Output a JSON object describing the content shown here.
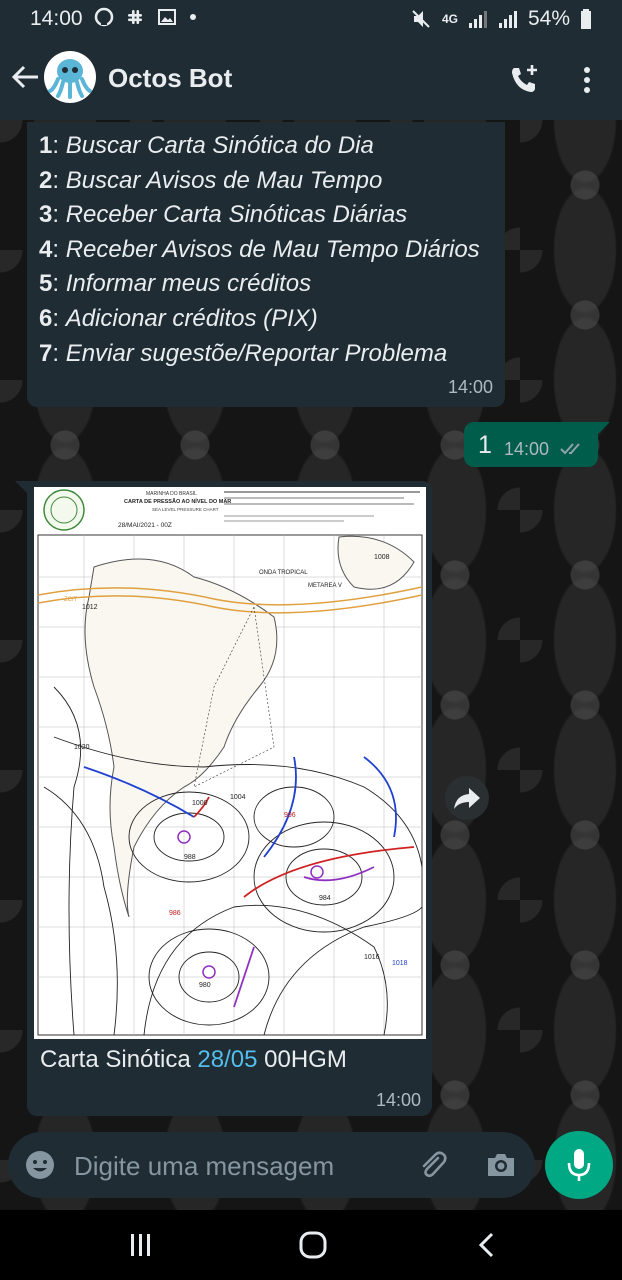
{
  "status_bar": {
    "time": "14:00",
    "battery": "54%",
    "network": "4G"
  },
  "header": {
    "contact_name": "Octos Bot"
  },
  "menu_message": {
    "items": [
      {
        "number": "1",
        "text": "Buscar Carta Sinótica do Dia"
      },
      {
        "number": "2",
        "text": "Buscar Avisos de Mau Tempo"
      },
      {
        "number": "3",
        "text": "Receber Carta Sinóticas Diárias"
      },
      {
        "number": "4",
        "text": "Receber Avisos de Mau Tempo Diários"
      },
      {
        "number": "5",
        "text": "Informar meus créditos"
      },
      {
        "number": "6",
        "text": "Adicionar créditos (PIX)"
      },
      {
        "number": "7",
        "text": "Enviar sugestõe/Reportar Problema"
      }
    ],
    "time": "14:00"
  },
  "sent_message": {
    "text": "1",
    "time": "14:00"
  },
  "image_message": {
    "chart": {
      "org": "MARINHA DO BRASIL",
      "title": "CARTA DE PRESSÃO AO NÍVEL DO MAR",
      "subtitle": "SEA LEVEL PRESSURE CHART",
      "date": "28/MAI/2021 - 00Z",
      "labels": [
        "1008",
        "1012",
        "1020",
        "1004",
        "1000",
        "996",
        "988",
        "984",
        "980",
        "1016",
        "1018",
        "ONDA TROPICAL",
        "METAREA V",
        "ZCIT",
        "986"
      ]
    },
    "caption_prefix": "Carta Sinótica ",
    "caption_link": "28/05",
    "caption_suffix": " 00HGM",
    "time": "14:00"
  },
  "composer": {
    "placeholder": "Digite uma mensagem"
  },
  "colors": {
    "bar": "#1f2c34",
    "bubble_in": "#1f2c34",
    "bubble_out": "#005c4b",
    "accent": "#00a884",
    "link": "#53bdeb"
  }
}
